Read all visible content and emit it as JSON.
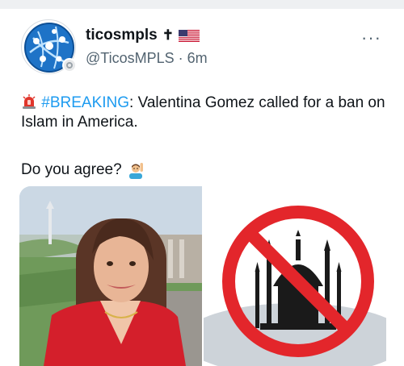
{
  "post": {
    "display_name": "ticosmpls",
    "name_suffix": "✝",
    "handle": "@TicosMPLS",
    "time_separator": "·",
    "time": "6m",
    "more_label": "···",
    "hashtag": "#BREAKING",
    "text_main": ": Valentina Gomez called for a ban on Islam in America.",
    "question": "Do you agree?",
    "link_color": "#1d9bf0",
    "icons": {
      "flag": "us-flag-icon",
      "siren": "siren-icon",
      "raising_hand": "person-raising-hand-icon",
      "verified_badge": "badge-icon"
    }
  }
}
